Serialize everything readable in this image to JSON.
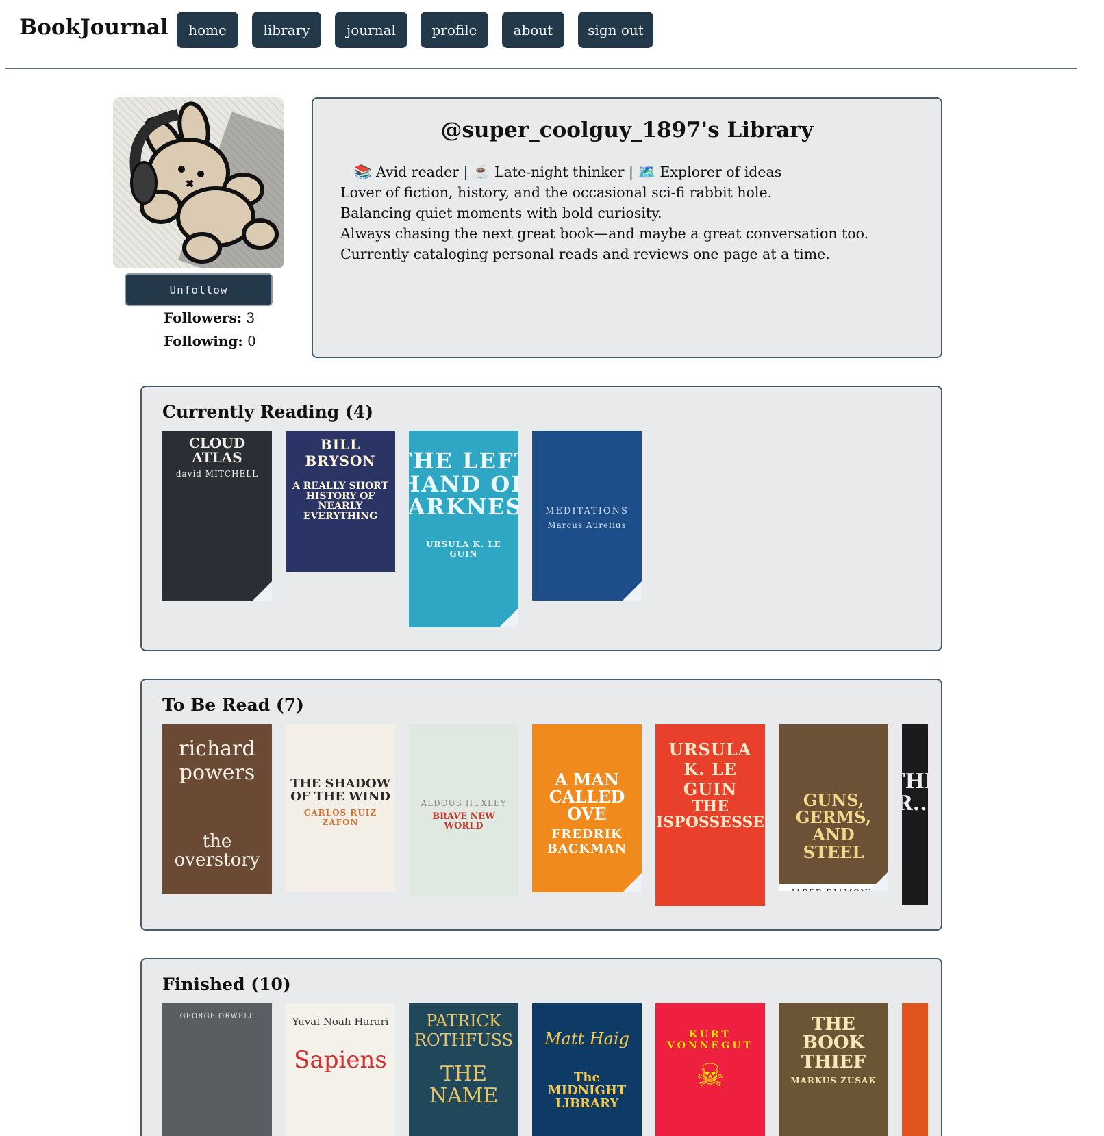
{
  "nav": {
    "brand": "BookJournal",
    "links": [
      "home",
      "library",
      "journal",
      "profile",
      "about",
      "sign out"
    ]
  },
  "profile": {
    "unfollow_label": "Unfollow",
    "followers_label": "Followers:",
    "followers_count": "3",
    "following_label": "Following:",
    "following_count": "0"
  },
  "bio": {
    "title": "@super_coolguy_1897's Library",
    "lines": [
      "📚 Avid reader | ☕ Late-night thinker | 🗺️ Explorer of ideas",
      "Lover of fiction, history, and the occasional sci-fi rabbit hole.",
      "Balancing quiet moments with bold curiosity.",
      "Always chasing the next great book—and maybe a great conversation too.",
      "Currently cataloging personal reads and reviews one page at a time."
    ]
  },
  "shelves": {
    "currently_reading": {
      "title": "Currently Reading (4)",
      "books": [
        {
          "title": "CLOUD ATLAS",
          "author": "david MITCHELL",
          "bg": "#2b2f35",
          "fg": "#f2efe6"
        },
        {
          "title": "A REALLY SHORT HISTORY OF NEARLY EVERYTHING",
          "author": "BILL BRYSON",
          "bg": "#2a3566",
          "fg": "#fff6d8"
        },
        {
          "title": "THE LEFT HAND OF DARKNESS",
          "author": "URSULA K. LE GUIN",
          "bg": "#2fa6c4",
          "fg": "#e9fbff"
        },
        {
          "title": "MEDITATIONS",
          "author": "Marcus Aurelius",
          "bg": "#1d4e8a",
          "fg": "#cfe0f5"
        }
      ]
    },
    "to_be_read": {
      "title": "To Be Read (7)",
      "books": [
        {
          "title": "the overstory",
          "author": "richard powers",
          "bg": "#6a4a35",
          "fg": "#f4f1e8"
        },
        {
          "title": "THE SHADOW OF THE WIND",
          "author": "CARLOS RUIZ ZAFÓN",
          "bg": "#f4efe6",
          "fg": "#2a2a2a"
        },
        {
          "title": "BRAVE NEW WORLD",
          "author": "ALDOUS HUXLEY",
          "bg": "#dfe9e2",
          "fg": "#c0392b"
        },
        {
          "title": "A MAN CALLED OVE",
          "author": "FREDRIK BACKMAN",
          "bg": "#f08a1c",
          "fg": "#ffffff"
        },
        {
          "title": "THE DISPOSSESSED",
          "author": "URSULA K. LE GUIN",
          "bg": "#e8402a",
          "fg": "#fde7c8"
        },
        {
          "title": "GUNS, GERMS, AND STEEL",
          "author": "JARED DIAMOND",
          "bg": "#6b5236",
          "fg": "#f3d889"
        },
        {
          "title": "THE R...",
          "author": "",
          "bg": "#1b1b1d",
          "fg": "#eeeeee"
        }
      ]
    },
    "finished": {
      "title": "Finished (10)",
      "books": [
        {
          "title": "",
          "author": "GEORGE ORWELL",
          "bg": "#5a5d61",
          "fg": "#e6e6e6"
        },
        {
          "title": "Sapiens",
          "author": "Yuval Noah Harari",
          "bg": "#f4f1ea",
          "fg": "#d62e2e"
        },
        {
          "title": "THE NAME",
          "author": "PATRICK ROTHFUSS",
          "bg": "#21485a",
          "fg": "#e8c46a"
        },
        {
          "title": "The MIDNIGHT LIBRARY",
          "author": "Matt Haig",
          "bg": "#0e3a66",
          "fg": "#f7c948"
        },
        {
          "title": "",
          "author": "KURT VONNEGUT",
          "bg": "#ee1f3f",
          "fg": "#ffe600"
        },
        {
          "title": "THE BOOK THIEF",
          "author": "MARKUS ZUSAK",
          "bg": "#6a5534",
          "fg": "#f6e7b6"
        },
        {
          "title": "",
          "author": "",
          "bg": "#e2541e",
          "fg": "#ffffff"
        }
      ]
    }
  },
  "colors": {
    "nav_button": "#233849",
    "panel": "#e8eaec",
    "panel_border": "#48596a"
  }
}
